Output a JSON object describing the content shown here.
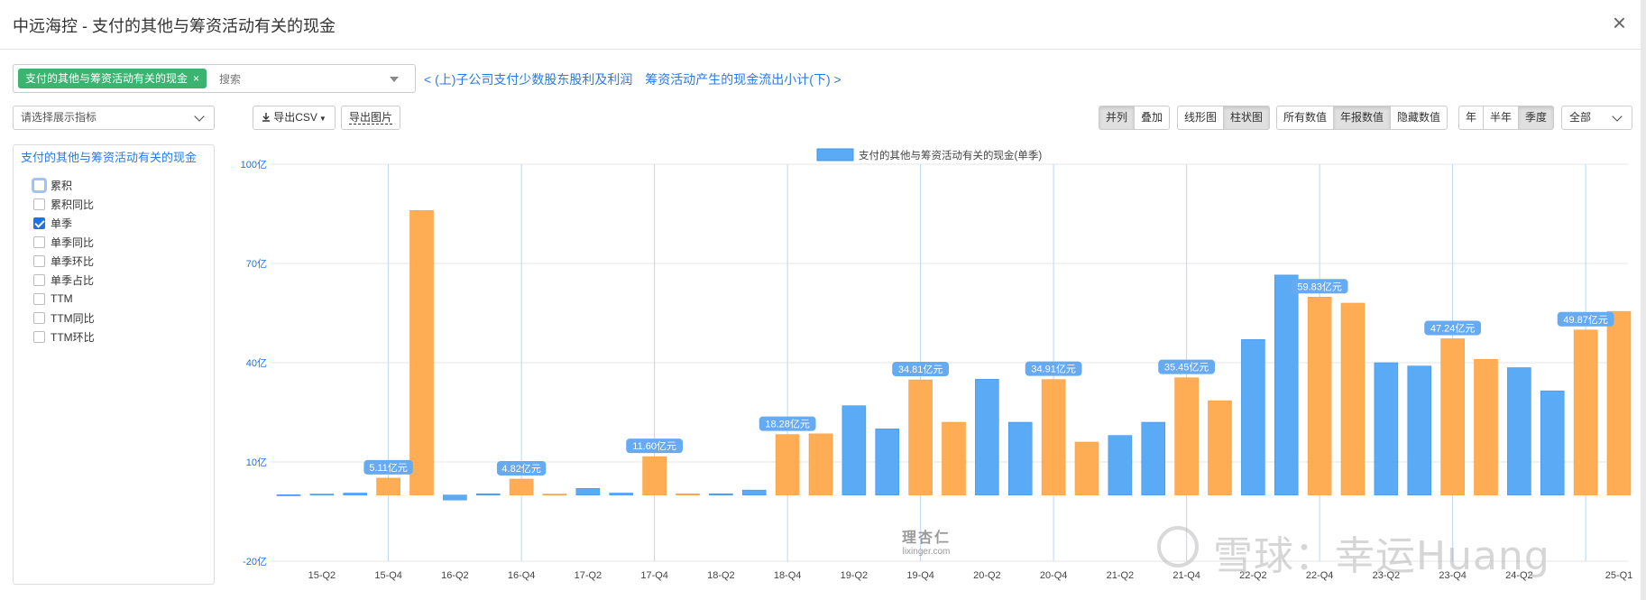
{
  "dialog": {
    "title": "中远海控 - 支付的其他与筹资活动有关的现金",
    "close_label": "×"
  },
  "selector": {
    "tag_label": "支付的其他与筹资活动有关的现金",
    "tag_remove": "×",
    "search_placeholder": "搜索",
    "prev_label": "< (上)子公司支付少数股东股利及利润",
    "next_label": "筹资活动产生的现金流出小计(下) >"
  },
  "toolbar": {
    "indicator_select": "请选择展示指标",
    "export_csv": "导出CSV",
    "export_image": "导出图片",
    "layout_buttons": [
      "并列",
      "叠加"
    ],
    "chart_type_buttons": [
      "线形图",
      "柱状图"
    ],
    "value_buttons": [
      "所有数值",
      "年报数值",
      "隐藏数值"
    ],
    "period_buttons": [
      "年",
      "半年",
      "季度"
    ],
    "range_select": "全部",
    "active": [
      "并列",
      "柱状图",
      "年报数值",
      "季度"
    ]
  },
  "panel": {
    "title": "支付的其他与筹资活动有关的现金",
    "options": [
      {
        "label": "累积",
        "checked": false
      },
      {
        "label": "累积同比",
        "checked": false
      },
      {
        "label": "单季",
        "checked": true
      },
      {
        "label": "单季同比",
        "checked": false
      },
      {
        "label": "单季环比",
        "checked": false
      },
      {
        "label": "单季占比",
        "checked": false
      },
      {
        "label": "TTM",
        "checked": false
      },
      {
        "label": "TTM同比",
        "checked": false
      },
      {
        "label": "TTM环比",
        "checked": false
      }
    ]
  },
  "watermark": {
    "brand": "理杏仁",
    "brand_url": "lixinger.com",
    "xueqiu": "雪球：幸运Huang"
  },
  "chart_data": {
    "type": "bar",
    "legend": "支付的其他与筹资活动有关的现金(单季)",
    "legend_position": "top-center",
    "colors": {
      "normal": "#5aaaf5",
      "annual": "#ffad55",
      "label_bg": "#66aaf2"
    },
    "y_ticks": [
      "100亿",
      "70亿",
      "40亿",
      "10亿",
      "-20亿"
    ],
    "ylim": [
      -20,
      100
    ],
    "grid": true,
    "x_tick_labels": [
      "15-Q2",
      "15-Q4",
      "16-Q2",
      "16-Q4",
      "17-Q2",
      "17-Q4",
      "18-Q2",
      "18-Q4",
      "19-Q2",
      "19-Q4",
      "20-Q2",
      "20-Q4",
      "21-Q2",
      "21-Q4",
      "22-Q2",
      "22-Q4",
      "23-Q2",
      "23-Q4",
      "24-Q2",
      "25-Q1"
    ],
    "categories": [
      "15-Q1",
      "15-Q2",
      "15-Q3",
      "15-Q4",
      "16-Q1",
      "16-Q2",
      "16-Q3",
      "16-Q4",
      "17-Q1",
      "17-Q2",
      "17-Q3",
      "17-Q4",
      "18-Q1",
      "18-Q2",
      "18-Q3",
      "18-Q4",
      "19-Q1",
      "19-Q2",
      "19-Q3",
      "19-Q4",
      "20-Q1",
      "20-Q2",
      "20-Q3",
      "20-Q4",
      "21-Q1",
      "21-Q2",
      "21-Q3",
      "21-Q4",
      "22-Q1",
      "22-Q2",
      "22-Q3",
      "22-Q4",
      "23-Q1",
      "23-Q2",
      "23-Q3",
      "23-Q4",
      "24-Q1",
      "24-Q2",
      "24-Q3",
      "24-Q4",
      "25-Q1"
    ],
    "values": [
      0.1,
      0.3,
      0.6,
      5.11,
      86,
      -1.5,
      0.4,
      4.82,
      0.3,
      2.0,
      0.6,
      11.6,
      0.4,
      0.4,
      1.5,
      18.28,
      18.5,
      27,
      20,
      34.81,
      22,
      35,
      22,
      34.91,
      16,
      18,
      22,
      35.45,
      28.5,
      47,
      66.5,
      59.83,
      58,
      40,
      39,
      47.24,
      41,
      38.5,
      31.5,
      49.87,
      55.5
    ],
    "annual_flags": [
      false,
      false,
      false,
      true,
      true,
      false,
      false,
      true,
      true,
      false,
      false,
      true,
      true,
      false,
      false,
      true,
      true,
      false,
      false,
      true,
      true,
      false,
      false,
      true,
      true,
      false,
      false,
      true,
      true,
      false,
      false,
      true,
      true,
      false,
      false,
      true,
      true,
      false,
      false,
      true,
      true
    ],
    "data_labels": [
      {
        "category": "15-Q4",
        "text": "5.11亿元"
      },
      {
        "category": "16-Q4",
        "text": "4.82亿元"
      },
      {
        "category": "17-Q4",
        "text": "11.60亿元"
      },
      {
        "category": "18-Q4",
        "text": "18.28亿元"
      },
      {
        "category": "19-Q4",
        "text": "34.81亿元"
      },
      {
        "category": "20-Q4",
        "text": "34.91亿元"
      },
      {
        "category": "21-Q4",
        "text": "35.45亿元"
      },
      {
        "category": "22-Q4",
        "text": "59.83亿元"
      },
      {
        "category": "23-Q4",
        "text": "47.24亿元"
      },
      {
        "category": "24-Q4",
        "text": "49.87亿元"
      }
    ]
  }
}
